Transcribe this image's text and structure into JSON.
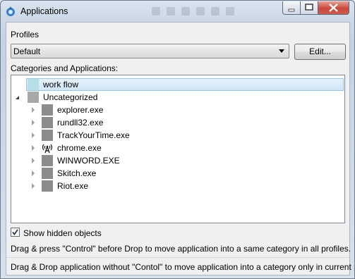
{
  "window": {
    "title": "Applications",
    "colors": {
      "accent": "#99c8ef",
      "close_button": "#c9483a"
    }
  },
  "profiles": {
    "label": "Profiles",
    "selected": "Default",
    "edit_label": "Edit..."
  },
  "tree": {
    "label": "Categories and Applications:",
    "categories": [
      {
        "name": "work flow",
        "expanded": false,
        "selected": true,
        "icon": "category-square-icon"
      },
      {
        "name": "Uncategorized",
        "expanded": true,
        "selected": false,
        "icon": "category-square-icon"
      }
    ],
    "apps": [
      {
        "name": "explorer.exe",
        "icon": "app-square-icon"
      },
      {
        "name": "rundll32.exe",
        "icon": "app-square-icon"
      },
      {
        "name": "TrackYourTime.exe",
        "icon": "app-square-icon"
      },
      {
        "name": "chrome.exe",
        "icon": "antenna-icon"
      },
      {
        "name": "WINWORD.EXE",
        "icon": "app-square-icon"
      },
      {
        "name": "Skitch.exe",
        "icon": "app-square-icon"
      },
      {
        "name": "Riot.exe",
        "icon": "app-square-icon"
      }
    ]
  },
  "options": {
    "show_hidden_label": "Show hidden objects",
    "show_hidden_checked": true
  },
  "hints": {
    "line1": "Drag & press \"Control\" before Drop to move application into a same category in all profiles.",
    "line2": "Drag & Drop application without \"Contol\" to move application into a category only in current profile."
  }
}
